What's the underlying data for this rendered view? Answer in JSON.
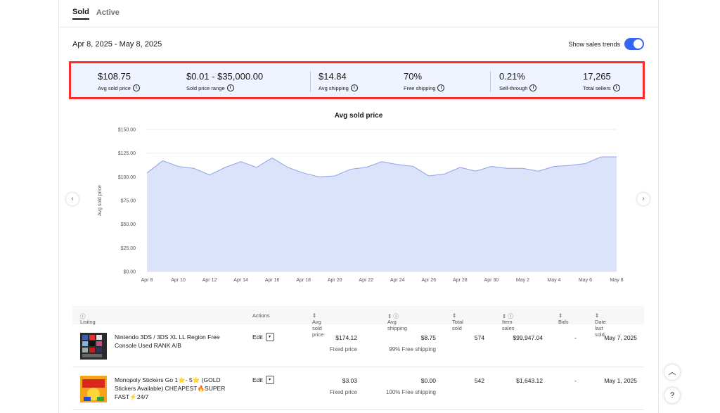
{
  "tabs": [
    {
      "label": "Sold"
    },
    {
      "label": "Active"
    }
  ],
  "date_range": "Apr 8, 2025 - May 8, 2025",
  "trends_label": "Show sales trends",
  "stats": [
    {
      "value": "$108.75",
      "label": "Avg sold price"
    },
    {
      "value": "$0.01 - $35,000.00",
      "label": "Sold price range"
    },
    {
      "value": "$14.84",
      "label": "Avg shipping"
    },
    {
      "value": "70%",
      "label": "Free shipping"
    },
    {
      "value": "0.21%",
      "label": "Sell-through"
    },
    {
      "value": "17,265",
      "label": "Total sellers"
    }
  ],
  "chart_data": {
    "type": "area",
    "title": "Avg sold price",
    "ylabel": "Avg sold price",
    "xlabel": "",
    "ylim": [
      0,
      150
    ],
    "yticks": [
      "$0.00",
      "$25.00",
      "$50.00",
      "$75.00",
      "$100.00",
      "$125.00",
      "$150.00"
    ],
    "x": [
      "Apr 8",
      "Apr 9",
      "Apr 10",
      "Apr 11",
      "Apr 12",
      "Apr 13",
      "Apr 14",
      "Apr 15",
      "Apr 16",
      "Apr 17",
      "Apr 18",
      "Apr 19",
      "Apr 20",
      "Apr 21",
      "Apr 22",
      "Apr 23",
      "Apr 24",
      "Apr 25",
      "Apr 26",
      "Apr 27",
      "Apr 28",
      "Apr 29",
      "Apr 30",
      "May 1",
      "May 2",
      "May 3",
      "May 4",
      "May 5",
      "May 6",
      "May 7",
      "May 8"
    ],
    "xtick_labels": [
      "Apr 8",
      "Apr 10",
      "Apr 12",
      "Apr 14",
      "Apr 16",
      "Apr 18",
      "Apr 20",
      "Apr 22",
      "Apr 24",
      "Apr 26",
      "Apr 28",
      "Apr 30",
      "May 2",
      "May 4",
      "May 6",
      "May 8"
    ],
    "values": [
      104,
      117,
      111,
      109,
      102,
      110,
      116,
      110,
      120,
      110,
      104,
      100,
      101,
      108,
      110,
      116,
      113,
      111,
      101,
      103,
      110,
      106,
      111,
      109,
      109,
      106,
      111,
      112,
      114,
      121,
      121
    ],
    "color": "#dbe3fb",
    "line_color": "#8fa2e8",
    "grid": true
  },
  "table": {
    "headers": {
      "listing": "Listing",
      "actions": "Actions",
      "avg_sold_price": "Avg sold price",
      "avg_shipping": "Avg shipping",
      "total_sold": "Total sold",
      "item_sales": "Item sales",
      "bids": "Bids",
      "date_last_sold": "Date last sold"
    },
    "rows": [
      {
        "title": "Nintendo 3DS / 3DS XL LL Region Free Console Used RANK A/B",
        "action": "Edit",
        "avg_price": "$174.12",
        "price_type": "Fixed price",
        "shipping": "$8.75",
        "free_ship": "99% Free shipping",
        "total_sold": "574",
        "item_sales": "$99,947.04",
        "bids": "-",
        "date": "May 7, 2025"
      },
      {
        "title": "Monopoly Stickers Go 1⭐- 5⭐ (GOLD Stickers Available) CHEAPEST🔥SUPER FAST⚡24/7",
        "action": "Edit",
        "avg_price": "$3.03",
        "price_type": "Fixed price",
        "shipping": "$0.00",
        "free_ship": "100% Free shipping",
        "total_sold": "542",
        "item_sales": "$1,643.12",
        "bids": "-",
        "date": "May 1, 2025"
      }
    ]
  }
}
